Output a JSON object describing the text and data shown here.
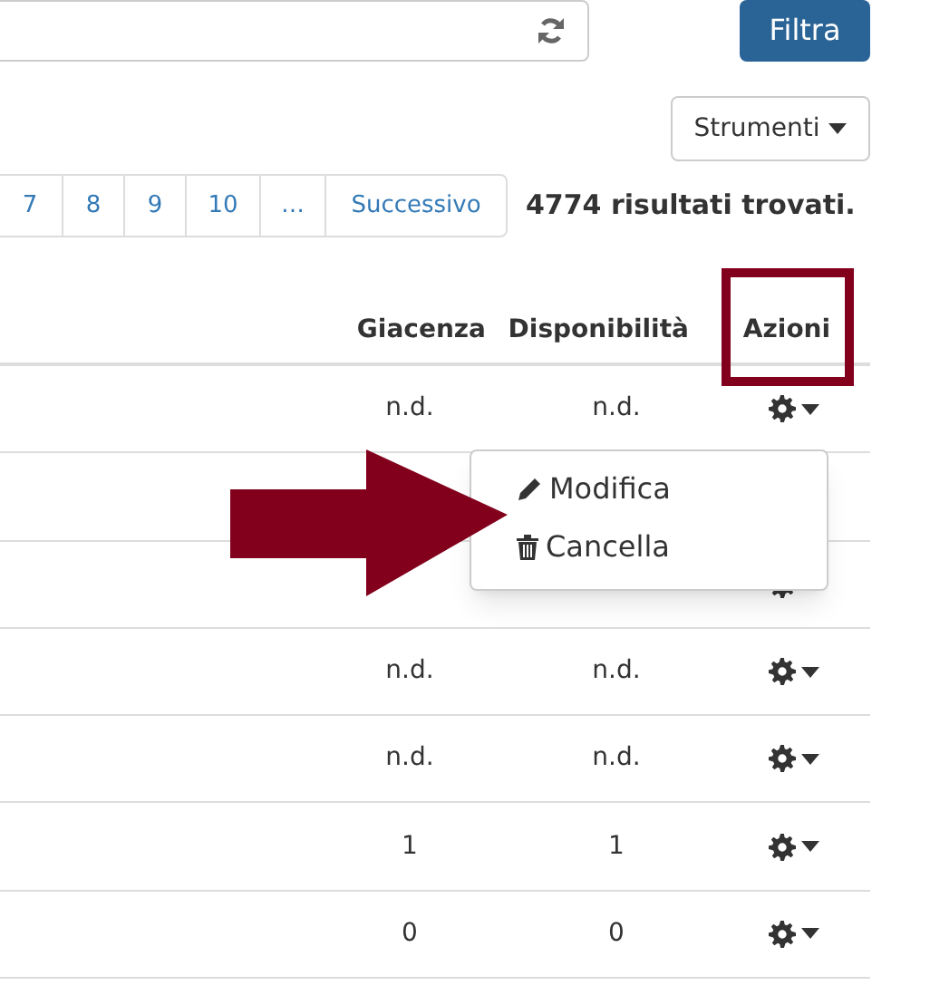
{
  "filter_button": "Filtra",
  "tools_button": "Strumenti",
  "pagination": [
    "7",
    "8",
    "9",
    "10",
    "…",
    "Successivo"
  ],
  "results": "4774 risultati trovati.",
  "table": {
    "columns": [
      "Giacenza",
      "Disponibilità",
      "Azioni"
    ],
    "rows": [
      {
        "giacenza": "n.d.",
        "disponibilita": "n.d."
      },
      {
        "kind": "covered"
      },
      {
        "kind": "partly_covered"
      },
      {
        "giacenza": "n.d.",
        "disponibilita": "n.d."
      },
      {
        "giacenza": "n.d.",
        "disponibilita": "n.d."
      },
      {
        "giacenza": "1",
        "disponibilita": "1"
      },
      {
        "giacenza": "0",
        "disponibilita": "0"
      }
    ]
  },
  "actions_menu": [
    {
      "kind": "edit",
      "label": "Modifica"
    },
    {
      "kind": "delete",
      "label": "Cancella"
    }
  ]
}
